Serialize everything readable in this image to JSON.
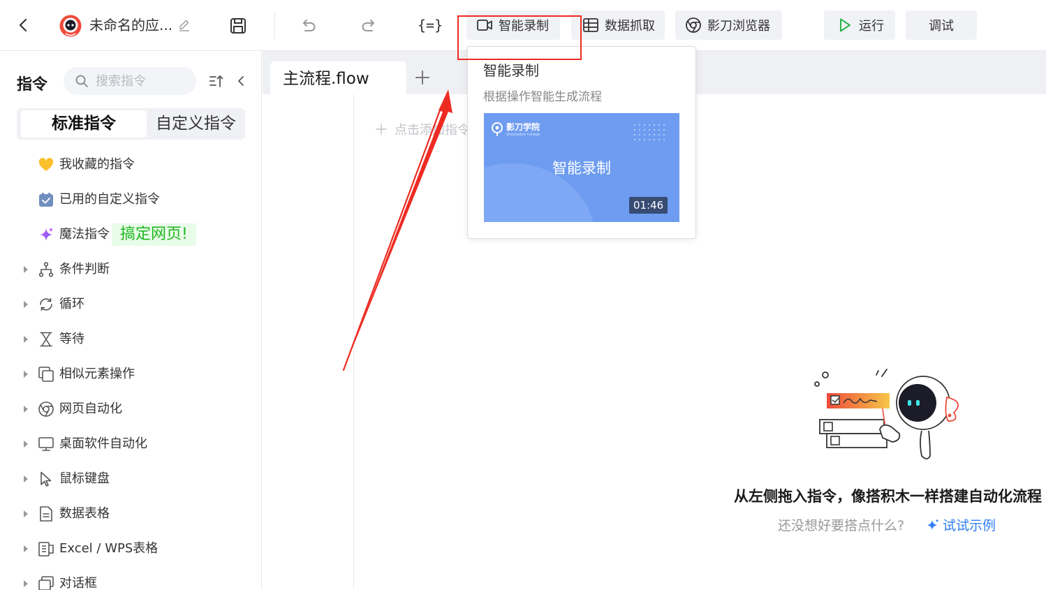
{
  "toolbar": {
    "app_title": "未命名的应...",
    "variables_label": "{=}",
    "smart_record_label": "智能录制",
    "data_scrape_label": "数据抓取",
    "browser_label": "影刀浏览器",
    "run_label": "运行",
    "debug_label": "调试"
  },
  "sidebar": {
    "title": "指令",
    "search_placeholder": "搜索指令",
    "tabs": [
      "标准指令",
      "自定义指令"
    ],
    "items": [
      {
        "label": "我收藏的指令"
      },
      {
        "label": "已用的自定义指令"
      },
      {
        "label": "魔法指令",
        "badge": "搞定网页!"
      },
      {
        "label": "条件判断"
      },
      {
        "label": "循环"
      },
      {
        "label": "等待"
      },
      {
        "label": "相似元素操作"
      },
      {
        "label": "网页自动化"
      },
      {
        "label": "桌面软件自动化"
      },
      {
        "label": "鼠标键盘"
      },
      {
        "label": "数据表格"
      },
      {
        "label": "Excel / WPS表格"
      },
      {
        "label": "对话框"
      }
    ]
  },
  "editor": {
    "tab_label": "主流程.flow",
    "add_command_hint": "点击添加指令",
    "empty_title": "从左侧拖入指令，像搭积木一样搭建自动化流程",
    "empty_hint": "还没想好要搭点什么?",
    "empty_link": "试试示例"
  },
  "popup": {
    "title": "智能录制",
    "description": "根据操作智能生成流程",
    "video_brand": "影刀学院",
    "video_brand_en": "Shadowbot College",
    "video_title": "智能录制",
    "video_duration": "01:46"
  },
  "colors": {
    "highlight_red": "#ee2b22",
    "link_blue": "#2f7ef5",
    "magic_green": "#1eb71e",
    "run_green": "#2bb34a",
    "video_blue": "#6e9cf0"
  }
}
